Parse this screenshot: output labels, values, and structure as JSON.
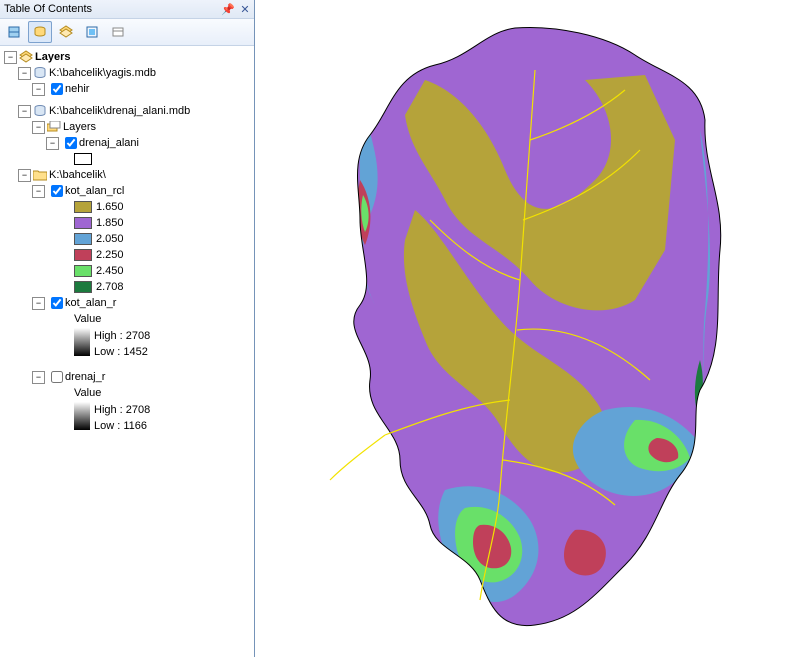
{
  "panel": {
    "title": "Table Of Contents"
  },
  "root": {
    "label": "Layers",
    "db1_path": "K:\\bahcelik\\yagis.mdb",
    "db1_layer": "nehir",
    "db2_path": "K:\\bahcelik\\drenaj_alani.mdb",
    "db2_group": "Layers",
    "db2_layer": "drenaj_alani",
    "folder_path": "K:\\bahcelik\\",
    "raster1": "kot_alan_rcl",
    "raster2": "kot_alan_r",
    "raster3": "drenaj_r",
    "value_label": "Value"
  },
  "classes": [
    {
      "color": "#b5a33a",
      "label": "1.650"
    },
    {
      "color": "#9f66d2",
      "label": "1.850"
    },
    {
      "color": "#62a3d6",
      "label": "2.050"
    },
    {
      "color": "#c0405a",
      "label": "2.250"
    },
    {
      "color": "#69e069",
      "label": "2.450"
    },
    {
      "color": "#1c7a3e",
      "label": "2.708"
    }
  ],
  "kot_alan_r": {
    "high": "High : 2708",
    "low": "Low : 1452"
  },
  "drenaj_r": {
    "high": "High : 2708",
    "low": "Low : 1166"
  },
  "chart_data": {
    "type": "map",
    "legend_field": "kot_alan_rcl",
    "classes": [
      {
        "value": 1.65,
        "color": "#b5a33a"
      },
      {
        "value": 1.85,
        "color": "#9f66d2"
      },
      {
        "value": 2.05,
        "color": "#62a3d6"
      },
      {
        "value": 2.25,
        "color": "#c0405a"
      },
      {
        "value": 2.45,
        "color": "#69e069"
      },
      {
        "value": 2.708,
        "color": "#1c7a3e"
      }
    ],
    "kot_alan_r_range": [
      1452,
      2708
    ],
    "drenaj_r_range": [
      1166,
      2708
    ],
    "overlays": [
      "nehir (stream lines, yellow)",
      "drenaj_alani (watershed boundary, black outline)"
    ]
  }
}
